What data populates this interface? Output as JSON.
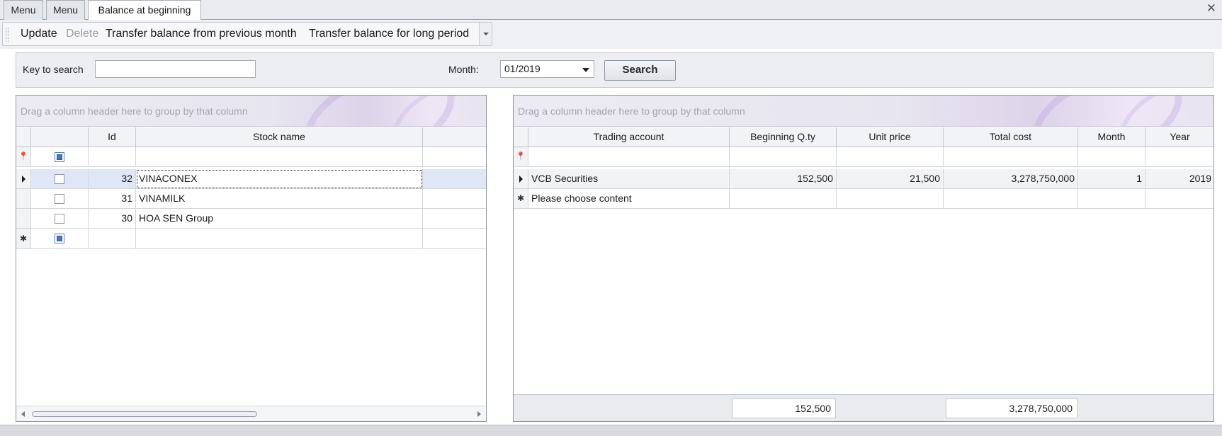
{
  "tabs": [
    {
      "label": "Menu",
      "active": false
    },
    {
      "label": "Menu",
      "active": false
    },
    {
      "label": "Balance at beginning",
      "active": true
    }
  ],
  "toolbar": {
    "update": "Update",
    "delete": "Delete",
    "transfer_prev": "Transfer balance from previous month",
    "transfer_long": "Transfer balance for long period"
  },
  "search": {
    "key_label": "Key to search",
    "key_value": "",
    "month_label": "Month:",
    "month_value": "01/2019",
    "button": "Search"
  },
  "left_grid": {
    "group_hint": "Drag a column header here to group by that column",
    "columns": {
      "id": "Id",
      "stock_name": "Stock name"
    },
    "rows": [
      {
        "id": "32",
        "name": "VINACONEX",
        "checked": false
      },
      {
        "id": "31",
        "name": "VINAMILK",
        "checked": false
      },
      {
        "id": "30",
        "name": "HOA SEN Group",
        "checked": false
      }
    ]
  },
  "right_grid": {
    "group_hint": "Drag a column header here to group by that column",
    "columns": {
      "trading_account": "Trading account",
      "beginning_qty": "Beginning Q.ty",
      "unit_price": "Unit price",
      "total_cost": "Total cost",
      "month": "Month",
      "year": "Year"
    },
    "rows": [
      {
        "account": "VCB Securities",
        "qty": "152,500",
        "price": "21,500",
        "total": "3,278,750,000",
        "month": "1",
        "year": "2019"
      }
    ],
    "new_row_text": "Please choose content",
    "totals": {
      "qty": "152,500",
      "total": "3,278,750,000"
    }
  },
  "colors": {
    "selected_row": "#dfe6f5",
    "accent": "#4a78c0"
  }
}
